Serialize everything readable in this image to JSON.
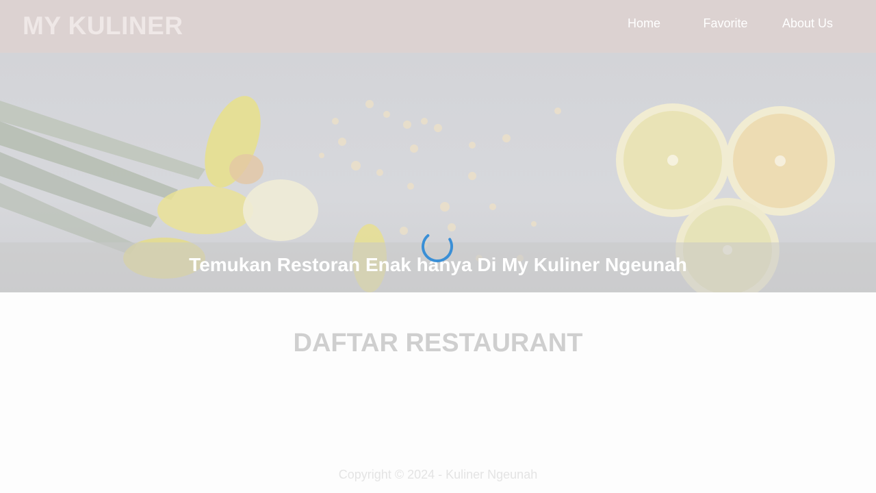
{
  "header": {
    "brand": "MY KULINER",
    "nav": [
      {
        "label": "Home"
      },
      {
        "label": "Favorite"
      },
      {
        "label": "About Us"
      }
    ]
  },
  "hero": {
    "title": "Temukan Restoran Enak hanya Di My Kuliner Ngeunah"
  },
  "main": {
    "section_title": "DAFTAR RESTAURANT"
  },
  "footer": {
    "copyright": "Copyright © 2024 - Kuliner Ngeunah"
  },
  "colors": {
    "header_bg": "#dcd2d1",
    "spinner": "#3a8fd6"
  }
}
